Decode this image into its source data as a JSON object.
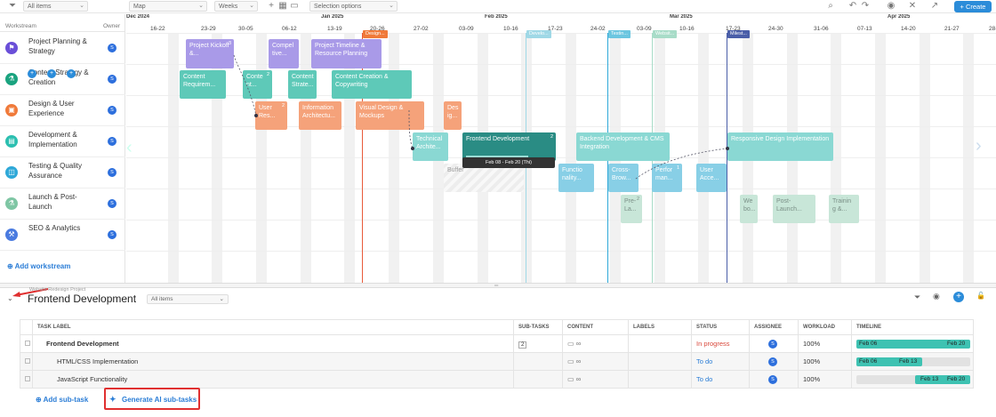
{
  "toolbar": {
    "filter_select": "All items",
    "view_select": "Map",
    "scale_select": "Weeks",
    "selection_select": "Selection options",
    "create_label": "+ Create"
  },
  "sidebar": {
    "header_workstream": "Workstream",
    "header_owner": "Owner",
    "add_label": "Add workstream",
    "workstreams": [
      {
        "label": "Project Planning & Strategy",
        "color": "#6a4fd8",
        "owner": "S"
      },
      {
        "label": "Content Strategy & Creation",
        "color": "#1aa37f",
        "owner": "S"
      },
      {
        "label": "Design & User Experience",
        "color": "#f07a3a",
        "owner": "S"
      },
      {
        "label": "Development & Implementation",
        "color": "#2bbfb0",
        "owner": "S"
      },
      {
        "label": "Testing & Quality Assurance",
        "color": "#2ea8d8",
        "owner": "S"
      },
      {
        "label": "Launch & Post-Launch",
        "color": "#7fc6a4",
        "owner": "S"
      },
      {
        "label": "SEO & Analytics",
        "color": "#4a7be0",
        "owner": "S"
      }
    ]
  },
  "timeline": {
    "months": [
      "Dec 2024",
      "Jan 2025",
      "Feb 2025",
      "Mar 2025",
      "Apr 2025"
    ],
    "weeks": [
      "16-22",
      "23-29",
      "30-05",
      "06-12",
      "13-19",
      "20-26",
      "27-02",
      "03-09",
      "10-16",
      "17-23",
      "24-02",
      "03-09",
      "10-16",
      "17-23",
      "24-30",
      "31-06",
      "07-13",
      "14-20",
      "21-27",
      "28-"
    ],
    "markers": [
      "Design...",
      "Develo...",
      "Testin...",
      "Websit...",
      "Milest..."
    ],
    "tooltip": "Feb 08 - Feb 20 (Thi)",
    "bars": [
      {
        "label": "Project Kickoff &...",
        "count": "3"
      },
      {
        "label": "Compel tive...",
        "count": ""
      },
      {
        "label": "Project Timeline & Resource Planning",
        "count": ""
      },
      {
        "label": "Content Requirem...",
        "count": ""
      },
      {
        "label": "Conte nt...",
        "count": "2"
      },
      {
        "label": "Content Strate...",
        "count": ""
      },
      {
        "label": "Content Creation & Copywriting",
        "count": ""
      },
      {
        "label": "User Res...",
        "count": "2"
      },
      {
        "label": "Information Architectu...",
        "count": ""
      },
      {
        "label": "Visual Design & Mockups",
        "count": ""
      },
      {
        "label": "Des ig...",
        "count": ""
      },
      {
        "label": "Technical Archite...",
        "count": ""
      },
      {
        "label": "Frontend Development",
        "count": "2"
      },
      {
        "label": "Backend Development & CMS Integration",
        "count": ""
      },
      {
        "label": "Responsive Design Implementation",
        "count": ""
      },
      {
        "label": "Buffer",
        "count": ""
      },
      {
        "label": "Functio nality...",
        "count": ""
      },
      {
        "label": "Cross-Brow...",
        "count": ""
      },
      {
        "label": "Perfor man...",
        "count": "1"
      },
      {
        "label": "User Acce...",
        "count": ""
      },
      {
        "label": "Pre-La...",
        "count": "2"
      },
      {
        "label": "We bo...",
        "count": ""
      },
      {
        "label": "Post-Launch...",
        "count": ""
      },
      {
        "label": "Trainin g &...",
        "count": ""
      }
    ]
  },
  "panel": {
    "breadcrumb": "Website Redesign Project",
    "title": "Frontend Development",
    "items_select": "All items",
    "columns": [
      "TASK LABEL",
      "SUB-TASKS",
      "CONTENT",
      "LABELS",
      "STATUS",
      "ASSIGNEE",
      "WORKLOAD",
      "TIMELINE"
    ],
    "rows": [
      {
        "label": "Frontend Development",
        "subtasks": "2",
        "status": "In progress",
        "assignee": "S",
        "workload": "100%",
        "tl_start": "Feb 06",
        "tl_mid": "",
        "tl_end": "Feb 20"
      },
      {
        "label": "HTML/CSS Implementation",
        "subtasks": "",
        "status": "To do",
        "assignee": "S",
        "workload": "100%",
        "tl_start": "Feb 06",
        "tl_mid": "Feb 13",
        "tl_end": ""
      },
      {
        "label": "JavaScript Functionality",
        "subtasks": "",
        "status": "To do",
        "assignee": "S",
        "workload": "100%",
        "tl_start": "",
        "tl_mid": "Feb 13",
        "tl_end": "Feb 20"
      }
    ],
    "add_subtask": "Add sub-task",
    "generate_ai": "Generate AI sub-tasks"
  }
}
